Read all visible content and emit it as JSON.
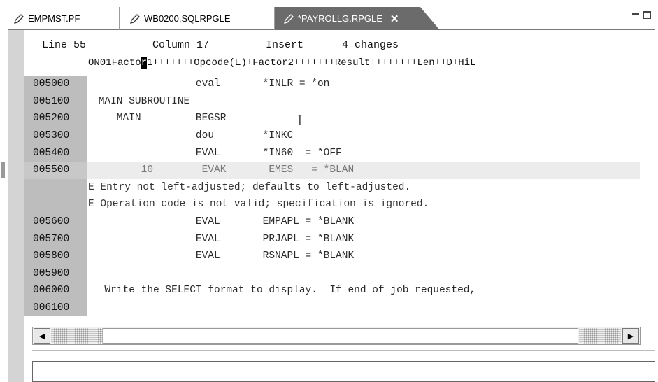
{
  "tabs": [
    {
      "label": "EMPMST.PF",
      "icon": "pencil-icon"
    },
    {
      "label": "WB0200.SQLRPGLE",
      "icon": "pencil-icon"
    },
    {
      "label": "*PAYROLLG.RPGLE",
      "icon": "pencil-icon",
      "close": "✕",
      "active": true
    }
  ],
  "status": {
    "line": "Line 55",
    "column": "Column 17",
    "mode": "Insert",
    "changes": "4 changes"
  },
  "ruler": {
    "before_cursor": "ON01Facto",
    "cursor_char": "r",
    "after_cursor": "1+++++++Opcode(E)+Factor2+++++++Result++++++++Len++D+HiL"
  },
  "lines": [
    {
      "seq": "005000",
      "code": "                 eval       *INLR = *on"
    },
    {
      "seq": "005100",
      "code": " MAIN SUBROUTINE"
    },
    {
      "seq": "005200",
      "code": "    MAIN         BEGSR"
    },
    {
      "seq": "005300",
      "code": "                 dou        *INKC"
    },
    {
      "seq": "005400",
      "code": "                 EVAL       *IN60  = *OFF"
    },
    {
      "seq": "005500",
      "code": "        10        EVAK       EMES   = *BLAN",
      "current": true
    },
    {
      "seq": "",
      "code": "E Entry not left-adjusted; defaults to left-adjusted.",
      "message": true
    },
    {
      "seq": "",
      "code": "E Operation code is not valid; specification is ignored.",
      "message": true
    },
    {
      "seq": "005600",
      "code": "                 EVAL       EMPAPL = *BLANK"
    },
    {
      "seq": "005700",
      "code": "                 EVAL       PRJAPL = *BLANK"
    },
    {
      "seq": "005800",
      "code": "                 EVAL       RSNAPL = *BLANK"
    },
    {
      "seq": "005900",
      "code": ""
    },
    {
      "seq": "006000",
      "code": "  Write the SELECT format to display.  If end of job requested,"
    },
    {
      "seq": "006100",
      "code": ""
    }
  ],
  "scroll": {
    "up_arrow": "▲",
    "down_arrow": "▼",
    "left_arrow": "◀",
    "right_arrow": "▶"
  },
  "command_line": {
    "value": ""
  }
}
